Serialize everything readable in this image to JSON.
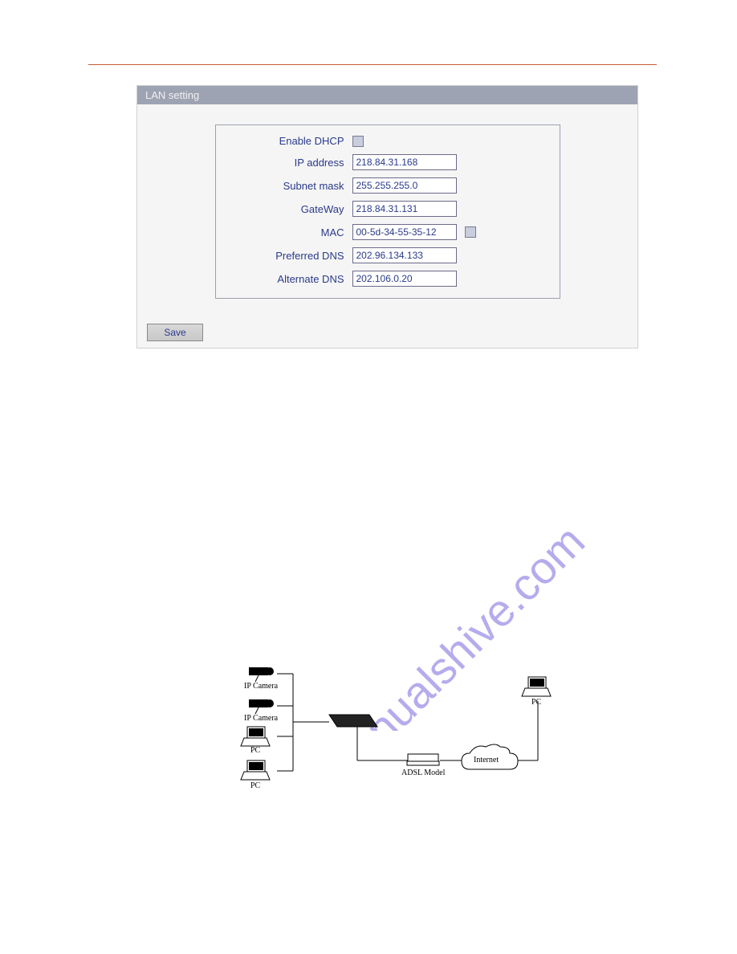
{
  "panel": {
    "title": "LAN setting",
    "rows": {
      "dhcp_label": "Enable DHCP",
      "ip_label": "IP address",
      "ip_value": "218.84.31.168",
      "subnet_label": "Subnet mask",
      "subnet_value": "255.255.255.0",
      "gateway_label": "GateWay",
      "gateway_value": "218.84.31.131",
      "mac_label": "MAC",
      "mac_value": "00-5d-34-55-35-12",
      "pref_dns_label": "Preferred DNS",
      "pref_dns_value": "202.96.134.133",
      "alt_dns_label": "Alternate DNS",
      "alt_dns_value": "202.106.0.20"
    },
    "save_button": "Save"
  },
  "watermark": "manualshive.com",
  "diagram": {
    "ip_camera_1": "IP Camera",
    "ip_camera_2": "IP Camera",
    "pc_1": "PC",
    "pc_2": "PC",
    "adsl": "ADSL Model",
    "internet": "Internet",
    "pc_right": "PC"
  }
}
